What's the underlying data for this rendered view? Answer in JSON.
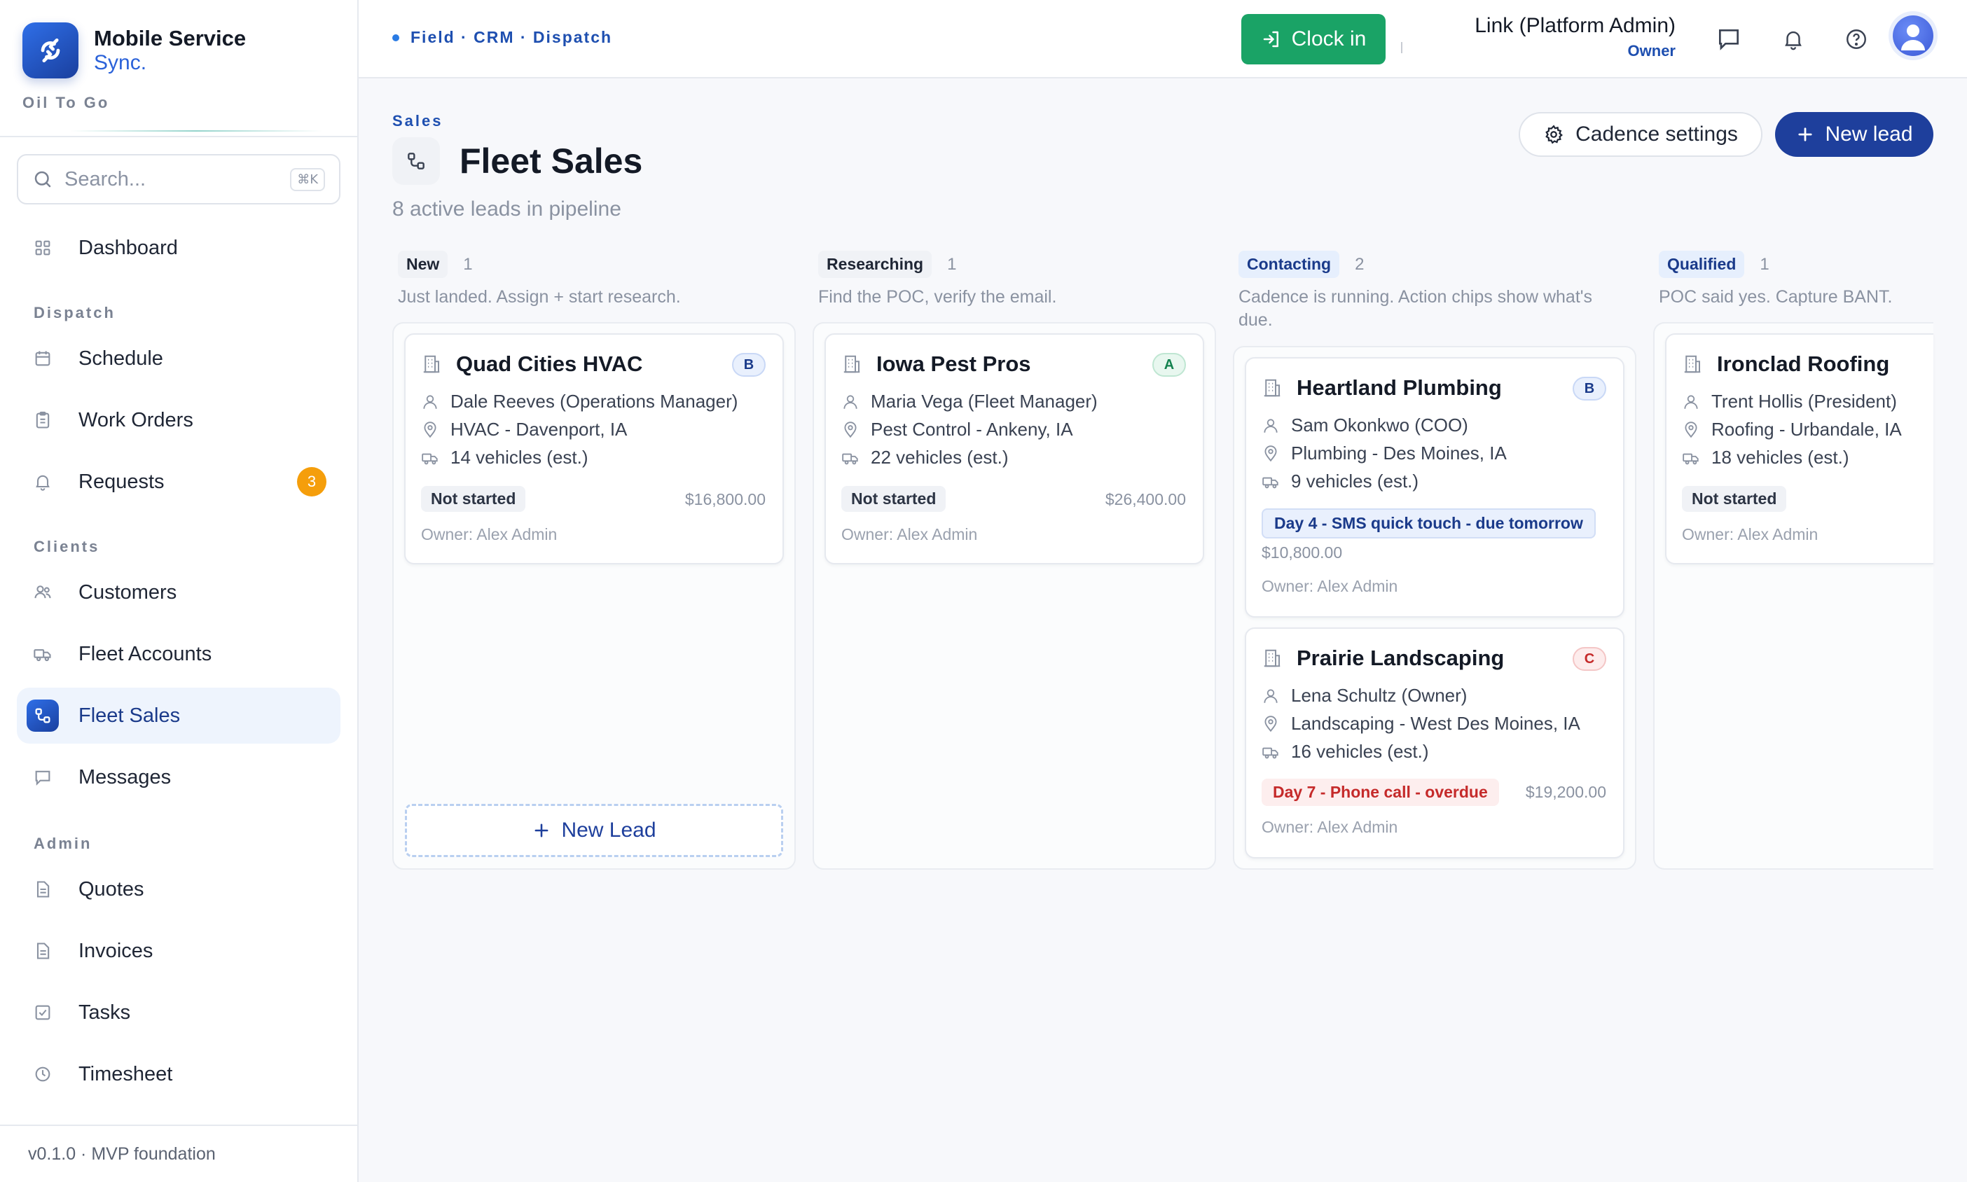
{
  "app": {
    "name": "Mobile Service",
    "name_sub": "Sync.",
    "org": "Oil To Go",
    "version": "v0.1.0 · MVP foundation"
  },
  "search": {
    "placeholder": "Search...",
    "shortcut": "⌘K"
  },
  "sidebar": {
    "dashboard": "Dashboard",
    "section_dispatch": "Dispatch",
    "schedule": "Schedule",
    "work_orders": "Work Orders",
    "requests": "Requests",
    "requests_badge": "3",
    "section_clients": "Clients",
    "customers": "Customers",
    "fleet_accounts": "Fleet Accounts",
    "fleet_sales": "Fleet Sales",
    "messages": "Messages",
    "section_admin": "Admin",
    "quotes": "Quotes",
    "invoices": "Invoices",
    "tasks": "Tasks",
    "timesheet": "Timesheet"
  },
  "topbar": {
    "breadcrumb": "Field · CRM · Dispatch",
    "clock_in": "Clock in",
    "user_name": "Link (Platform Admin)",
    "user_role": "Owner"
  },
  "page": {
    "eyebrow": "Sales",
    "title": "Fleet Sales",
    "subtitle": "8 active leads in pipeline",
    "cadence_settings": "Cadence settings",
    "new_lead": "New lead",
    "new_lead_inline": "New Lead"
  },
  "columns": [
    {
      "stage": "New",
      "count": "1",
      "desc": "Just landed. Assign + start research."
    },
    {
      "stage": "Researching",
      "count": "1",
      "desc": "Find the POC, verify the email."
    },
    {
      "stage": "Contacting",
      "count": "2",
      "desc": "Cadence is running. Action chips show what's due."
    },
    {
      "stage": "Qualified",
      "count": "1",
      "desc": "POC said yes. Capture BANT."
    }
  ],
  "cards": [
    {
      "company": "Quad Cities HVAC",
      "grade": "B",
      "contact": "Dale Reeves (Operations Manager)",
      "location": "HVAC - Davenport, IA",
      "vehicles": "14 vehicles (est.)",
      "status": "Not started",
      "amount": "$16,800.00",
      "owner": "Owner: Alex Admin"
    },
    {
      "company": "Iowa Pest Pros",
      "grade": "A",
      "contact": "Maria Vega (Fleet Manager)",
      "location": "Pest Control - Ankeny, IA",
      "vehicles": "22 vehicles (est.)",
      "status": "Not started",
      "amount": "$26,400.00",
      "owner": "Owner: Alex Admin"
    },
    {
      "company": "Heartland Plumbing",
      "grade": "B",
      "contact": "Sam Okonkwo (COO)",
      "location": "Plumbing - Des Moines, IA",
      "vehicles": "9 vehicles (est.)",
      "action": "Day 4 - SMS quick touch - due tomorrow",
      "amount": "$10,800.00",
      "owner": "Owner: Alex Admin"
    },
    {
      "company": "Prairie Landscaping",
      "grade": "C",
      "contact": "Lena Schultz (Owner)",
      "location": "Landscaping - West Des Moines, IA",
      "vehicles": "16 vehicles (est.)",
      "action": "Day 7 - Phone call - overdue",
      "amount": "$19,200.00",
      "owner": "Owner: Alex Admin"
    },
    {
      "company": "Ironclad Roofing",
      "contact": "Trent Hollis (President)",
      "location": "Roofing - Urbandale, IA",
      "vehicles": "18 vehicles (est.)",
      "status": "Not started",
      "owner": "Owner: Alex Admin"
    }
  ],
  "colors": {
    "accent": "#1e3f9c",
    "success": "#1aa366",
    "warning": "#f59e0b",
    "danger": "#c52a2a"
  }
}
